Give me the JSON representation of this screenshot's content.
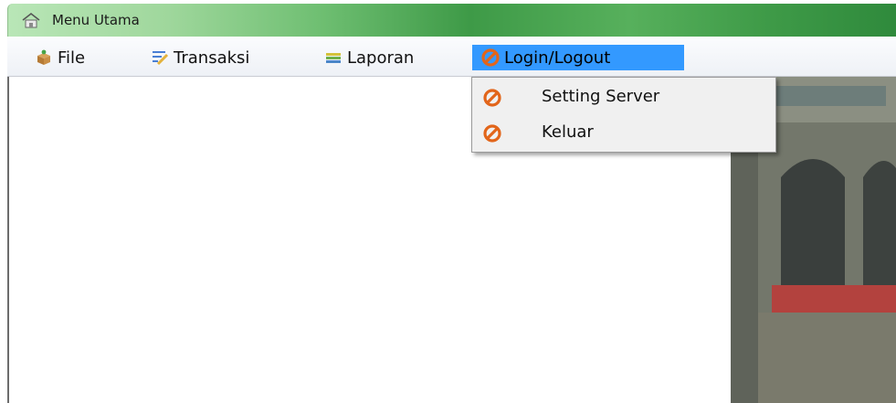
{
  "window": {
    "title": "Menu Utama"
  },
  "menubar": {
    "items": [
      {
        "label": "File",
        "icon": "box-icon"
      },
      {
        "label": "Transaksi",
        "icon": "pencil-list-icon"
      },
      {
        "label": "Laporan",
        "icon": "report-icon"
      },
      {
        "label": "Login/Logout",
        "icon": "no-entry-icon",
        "active": true
      }
    ]
  },
  "dropdown": {
    "items": [
      {
        "label": "Setting Server",
        "icon": "no-entry-icon"
      },
      {
        "label": "Keluar",
        "icon": "no-entry-icon"
      }
    ]
  },
  "colors": {
    "active_menu": "#3399ff",
    "no_entry_icon": "#e2651a",
    "titlebar_green": "#3e9a47"
  }
}
